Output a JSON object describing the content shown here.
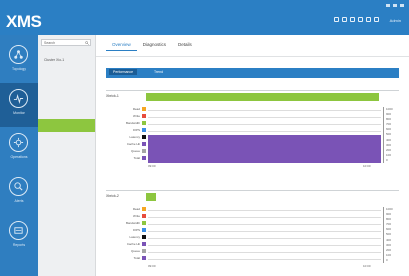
{
  "app": {
    "logo": "XMS",
    "user": "Admin"
  },
  "top_icons": [
    "home-icon",
    "refresh-icon",
    "settings-icon",
    "chart-icon",
    "help-icon",
    "user-icon"
  ],
  "nav": [
    {
      "label": "Topology",
      "icon": "topology-icon",
      "active": false
    },
    {
      "label": "Monitor",
      "icon": "monitor-icon",
      "active": true
    },
    {
      "label": "Operations",
      "icon": "operations-icon",
      "active": false
    },
    {
      "label": "Alerts",
      "icon": "alerts-icon",
      "active": false
    },
    {
      "label": "Reports",
      "icon": "reports-icon",
      "active": false
    }
  ],
  "search": {
    "placeholder": "Search"
  },
  "tree": {
    "item": "Cluster Xio-1"
  },
  "tabs": [
    "Overview",
    "Diagnostics",
    "Details"
  ],
  "subtabs": [
    "Performance",
    "Trend"
  ],
  "sections": [
    {
      "label": "Xbrick-1",
      "bar_fraction": 0.95
    },
    {
      "label": "Xbrick-2",
      "bar_fraction": 0.04
    }
  ],
  "rows": [
    "Read",
    "Write",
    "Bandwidth",
    "IOPS",
    "Latency",
    "Cache Hit",
    "Queue",
    "Total"
  ],
  "row_colors": [
    "#f5a623",
    "#e74c3c",
    "#8dc63f",
    "#3a8ee6",
    "#111111",
    "#7a53b6",
    "#a6a6a6",
    "#7a53b6"
  ],
  "right_ticks": [
    "1000",
    "900",
    "800",
    "700",
    "600",
    "500",
    "400",
    "300",
    "200",
    "100",
    "0"
  ],
  "axis": {
    "left": "09:00",
    "right": "10:00"
  },
  "colors": {
    "accent": "#2b7fc4",
    "nav_bg": "#2f7ec0",
    "green": "#8dc63f",
    "purple": "#7a53b6"
  }
}
